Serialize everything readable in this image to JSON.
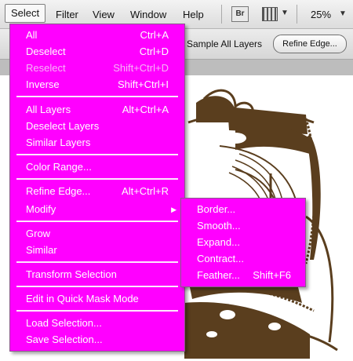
{
  "menubar": {
    "items": [
      "Select",
      "Filter",
      "View",
      "Window",
      "Help"
    ],
    "br_label": "Br",
    "zoom": "25%"
  },
  "options": {
    "sample_all_layers": "Sample All Layers",
    "refine_edge": "Refine Edge..."
  },
  "select_menu": [
    {
      "label": "All",
      "shortcut": "Ctrl+A"
    },
    {
      "label": "Deselect",
      "shortcut": "Ctrl+D"
    },
    {
      "label": "Reselect",
      "shortcut": "Shift+Ctrl+D",
      "disabled": true
    },
    {
      "label": "Inverse",
      "shortcut": "Shift+Ctrl+I"
    },
    {
      "label": "All Layers",
      "shortcut": "Alt+Ctrl+A"
    },
    {
      "label": "Deselect Layers",
      "shortcut": ""
    },
    {
      "label": "Similar Layers",
      "shortcut": ""
    },
    {
      "label": "Color Range...",
      "shortcut": ""
    },
    {
      "label": "Refine Edge...",
      "shortcut": "Alt+Ctrl+R"
    },
    {
      "label": "Modify",
      "shortcut": ""
    },
    {
      "label": "Grow",
      "shortcut": ""
    },
    {
      "label": "Similar",
      "shortcut": ""
    },
    {
      "label": "Transform Selection",
      "shortcut": ""
    },
    {
      "label": "Edit in Quick Mask Mode",
      "shortcut": ""
    },
    {
      "label": "Load Selection...",
      "shortcut": ""
    },
    {
      "label": "Save Selection...",
      "shortcut": ""
    }
  ],
  "modify_submenu": [
    {
      "label": "Border...",
      "shortcut": ""
    },
    {
      "label": "Smooth...",
      "shortcut": ""
    },
    {
      "label": "Expand...",
      "shortcut": ""
    },
    {
      "label": "Contract...",
      "shortcut": ""
    },
    {
      "label": "Feather...",
      "shortcut": "Shift+F6"
    }
  ],
  "colors": {
    "menu_bg": "#ff00ff",
    "menu_text": "#ffffff",
    "art_brown": "#5a3e1e"
  }
}
